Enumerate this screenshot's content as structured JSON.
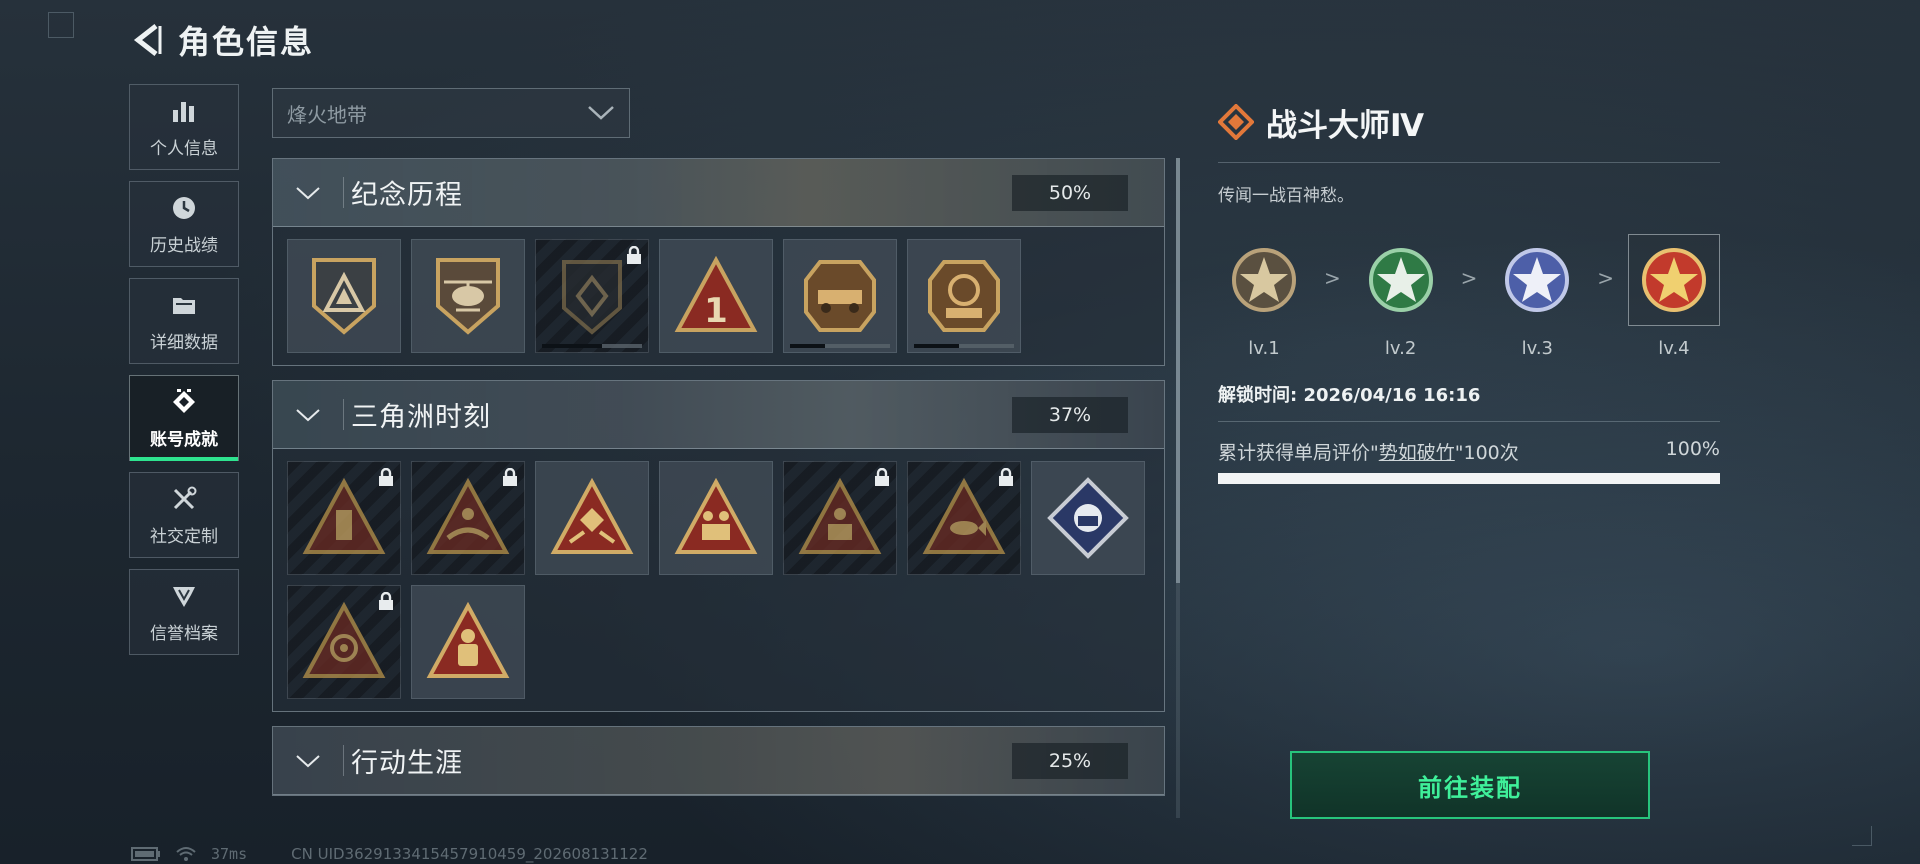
{
  "header": {
    "title": "角色信息",
    "back_icon": "back-arrow-icon"
  },
  "sidebar": {
    "items": [
      {
        "label": "个人信息",
        "icon": "bar-chart-icon",
        "active": false
      },
      {
        "label": "历史战绩",
        "icon": "clock-icon",
        "active": false
      },
      {
        "label": "详细数据",
        "icon": "folder-icon",
        "active": false
      },
      {
        "label": "账号成就",
        "icon": "achievement-diamond-icon",
        "active": true
      },
      {
        "label": "社交定制",
        "icon": "tools-icon",
        "active": false
      },
      {
        "label": "信誉档案",
        "icon": "shield-wing-icon",
        "active": false
      }
    ]
  },
  "mode_select": {
    "value": "烽火地带"
  },
  "sections": [
    {
      "title": "纪念历程",
      "percent": "50%",
      "badges": [
        {
          "icon": "triangle-shield-badge-icon",
          "locked": false,
          "progress": null
        },
        {
          "icon": "helicopter-badge-icon",
          "locked": false,
          "progress": null
        },
        {
          "icon": "dark-shield-badge-icon",
          "locked": true,
          "progress": 0.6
        },
        {
          "icon": "number-one-triangle-badge-icon",
          "locked": false,
          "progress": null
        },
        {
          "icon": "delta-force-vehicle-badge-icon",
          "locked": false,
          "progress": 0.35
        },
        {
          "icon": "delta-force-2025-badge-icon",
          "locked": false,
          "progress": 0.45
        }
      ]
    },
    {
      "title": "三角洲时刻",
      "percent": "37%",
      "badges": [
        {
          "icon": "usb-triangle-badge-icon",
          "locked": true
        },
        {
          "icon": "swimmer-triangle-badge-icon",
          "locked": true
        },
        {
          "icon": "diamond-hands-triangle-badge-icon",
          "locked": false
        },
        {
          "icon": "soldiers-triangle-badge-icon",
          "locked": false
        },
        {
          "icon": "crew-triangle-badge-icon",
          "locked": true
        },
        {
          "icon": "fish-triangle-badge-icon",
          "locked": true
        },
        {
          "icon": "fist-diamond-badge-icon",
          "locked": false
        },
        {
          "icon": "mask-triangle-badge-icon",
          "locked": true
        },
        {
          "icon": "hazmat-triangle-badge-icon",
          "locked": false
        }
      ]
    },
    {
      "title": "行动生涯",
      "percent": "25%",
      "badges": []
    }
  ],
  "detail": {
    "title": "战斗大师Ⅳ",
    "icon": "orange-diamond-icon",
    "description": "传闻一战百神愁。",
    "levels": [
      {
        "label": "lv.1",
        "color": "#b9a27a",
        "icon": "tan-star-medal-icon"
      },
      {
        "label": "lv.2",
        "color": "#2f7a45",
        "icon": "green-star-medal-icon"
      },
      {
        "label": "lv.3",
        "color": "#4d5fa8",
        "icon": "blue-star-medal-icon"
      },
      {
        "label": "lv.4",
        "color": "#c23a2c",
        "icon": "red-star-medal-icon"
      }
    ],
    "separator": ">",
    "unlock_time": "解锁时间: 2026/04/16 16:16",
    "task": {
      "prefix": "累计获得单局评价\"",
      "keyword": "势如破竹",
      "suffix": "\"100次",
      "percent": "100%",
      "progress": 1.0
    }
  },
  "equip_button": {
    "label": "前往装配"
  },
  "footer": {
    "ping": "37ms",
    "uid": "CN UID3629133415457910459_202608131122"
  },
  "colors": {
    "accent_green": "#2ee38f",
    "badge_gold": "#c8a360",
    "detail_orange": "#e2783a"
  }
}
